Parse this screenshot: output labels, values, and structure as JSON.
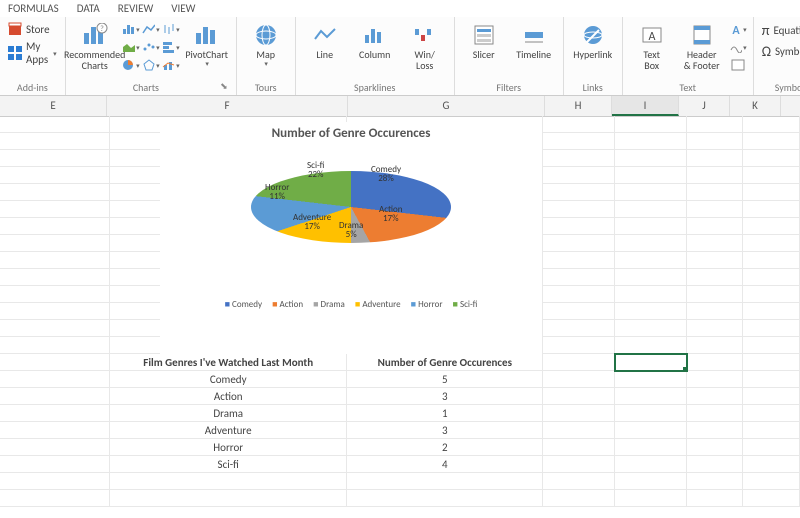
{
  "tabs": [
    "FORMULAS",
    "DATA",
    "REVIEW",
    "VIEW"
  ],
  "ribbon": {
    "addins": {
      "label": "Add-ins",
      "store": "Store",
      "myapps": "My Apps"
    },
    "charts": {
      "label": "Charts",
      "rec": "Recommended\nCharts",
      "pivot": "PivotChart"
    },
    "tours": {
      "label": "Tours",
      "map": "Map"
    },
    "spark": {
      "label": "Sparklines",
      "line": "Line",
      "col": "Column",
      "wl": "Win/\nLoss"
    },
    "filters": {
      "label": "Filters",
      "slicer": "Slicer",
      "tl": "Timeline"
    },
    "links": {
      "label": "Links",
      "hl": "Hyperlink"
    },
    "text": {
      "label": "Text",
      "tb": "Text\nBox",
      "hf": "Header\n& Footer"
    },
    "symbols": {
      "label": "Symbols",
      "eq": "Equation",
      "sym": "Symbol"
    }
  },
  "columns": [
    "E",
    "F",
    "G",
    "H",
    "I",
    "J",
    "K"
  ],
  "active_col": "I",
  "chart_data": {
    "type": "pie",
    "title": "Number of Genre Occurences",
    "series": [
      {
        "name": "Comedy",
        "value": 5,
        "pct": "28%",
        "color": "#4472C4"
      },
      {
        "name": "Action",
        "value": 3,
        "pct": "17%",
        "color": "#ED7D31"
      },
      {
        "name": "Drama",
        "value": 1,
        "pct": "5%",
        "color": "#A5A5A5"
      },
      {
        "name": "Adventure",
        "value": 3,
        "pct": "17%",
        "color": "#FFC000"
      },
      {
        "name": "Horror",
        "value": 2,
        "pct": "11%",
        "color": "#5B9BD5"
      },
      {
        "name": "Sci-fi",
        "value": 4,
        "pct": "22%",
        "color": "#70AD47"
      }
    ]
  },
  "table": {
    "headers": {
      "f": "Film Genres I've Watched Last Month",
      "g": "Number of Genre Occurences"
    },
    "rows": [
      {
        "f": "Comedy",
        "g": "5"
      },
      {
        "f": "Action",
        "g": "3"
      },
      {
        "f": "Drama",
        "g": "1"
      },
      {
        "f": "Adventure",
        "g": "3"
      },
      {
        "f": "Horror",
        "g": "2"
      },
      {
        "f": "Sci-fi",
        "g": "4"
      }
    ]
  }
}
